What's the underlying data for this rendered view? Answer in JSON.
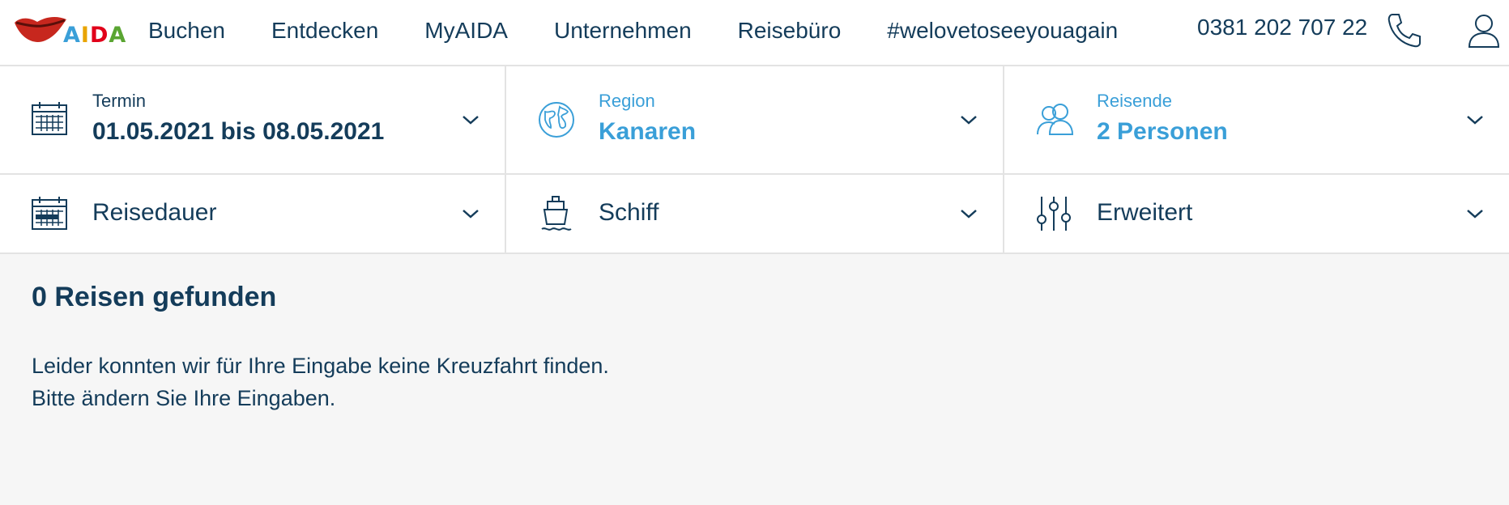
{
  "brand": {
    "name": "AIDA",
    "letter_colors": [
      "#3a9fd8",
      "#e9a400",
      "#e1001a",
      "#5aa532"
    ],
    "lips_color": "#c7271e"
  },
  "nav": {
    "items": [
      "Buchen",
      "Entdecken",
      "MyAIDA",
      "Unternehmen",
      "Reisebüro",
      "#welovetoseeyouagain"
    ],
    "phone": "0381 202 707 22",
    "phone_icon": "phone-icon",
    "user_icon": "user-icon"
  },
  "filters": {
    "termin": {
      "label": "Termin",
      "value": "01.05.2021 bis 08.05.2021",
      "icon": "calendar-icon"
    },
    "region": {
      "label": "Region",
      "value": "Kanaren",
      "icon": "globe-icon"
    },
    "reisende": {
      "label": "Reisende",
      "value": "2 Personen",
      "icon": "people-icon"
    },
    "reisedauer": {
      "label": "Reisedauer",
      "icon": "duration-calendar-icon"
    },
    "schiff": {
      "label": "Schiff",
      "icon": "ship-icon"
    },
    "erweitert": {
      "label": "Erweitert",
      "icon": "sliders-icon"
    }
  },
  "results": {
    "count_text": "0 Reisen gefunden",
    "message_line1": "Leider konnten wir für Ihre Eingabe keine Kreuzfahrt finden.",
    "message_line2": "Bitte ändern Sie Ihre Eingaben."
  },
  "colors": {
    "dark_blue": "#143c5a",
    "accent_blue": "#3a9fd8",
    "divider": "#e3e3e3",
    "results_bg": "#f6f6f6"
  }
}
